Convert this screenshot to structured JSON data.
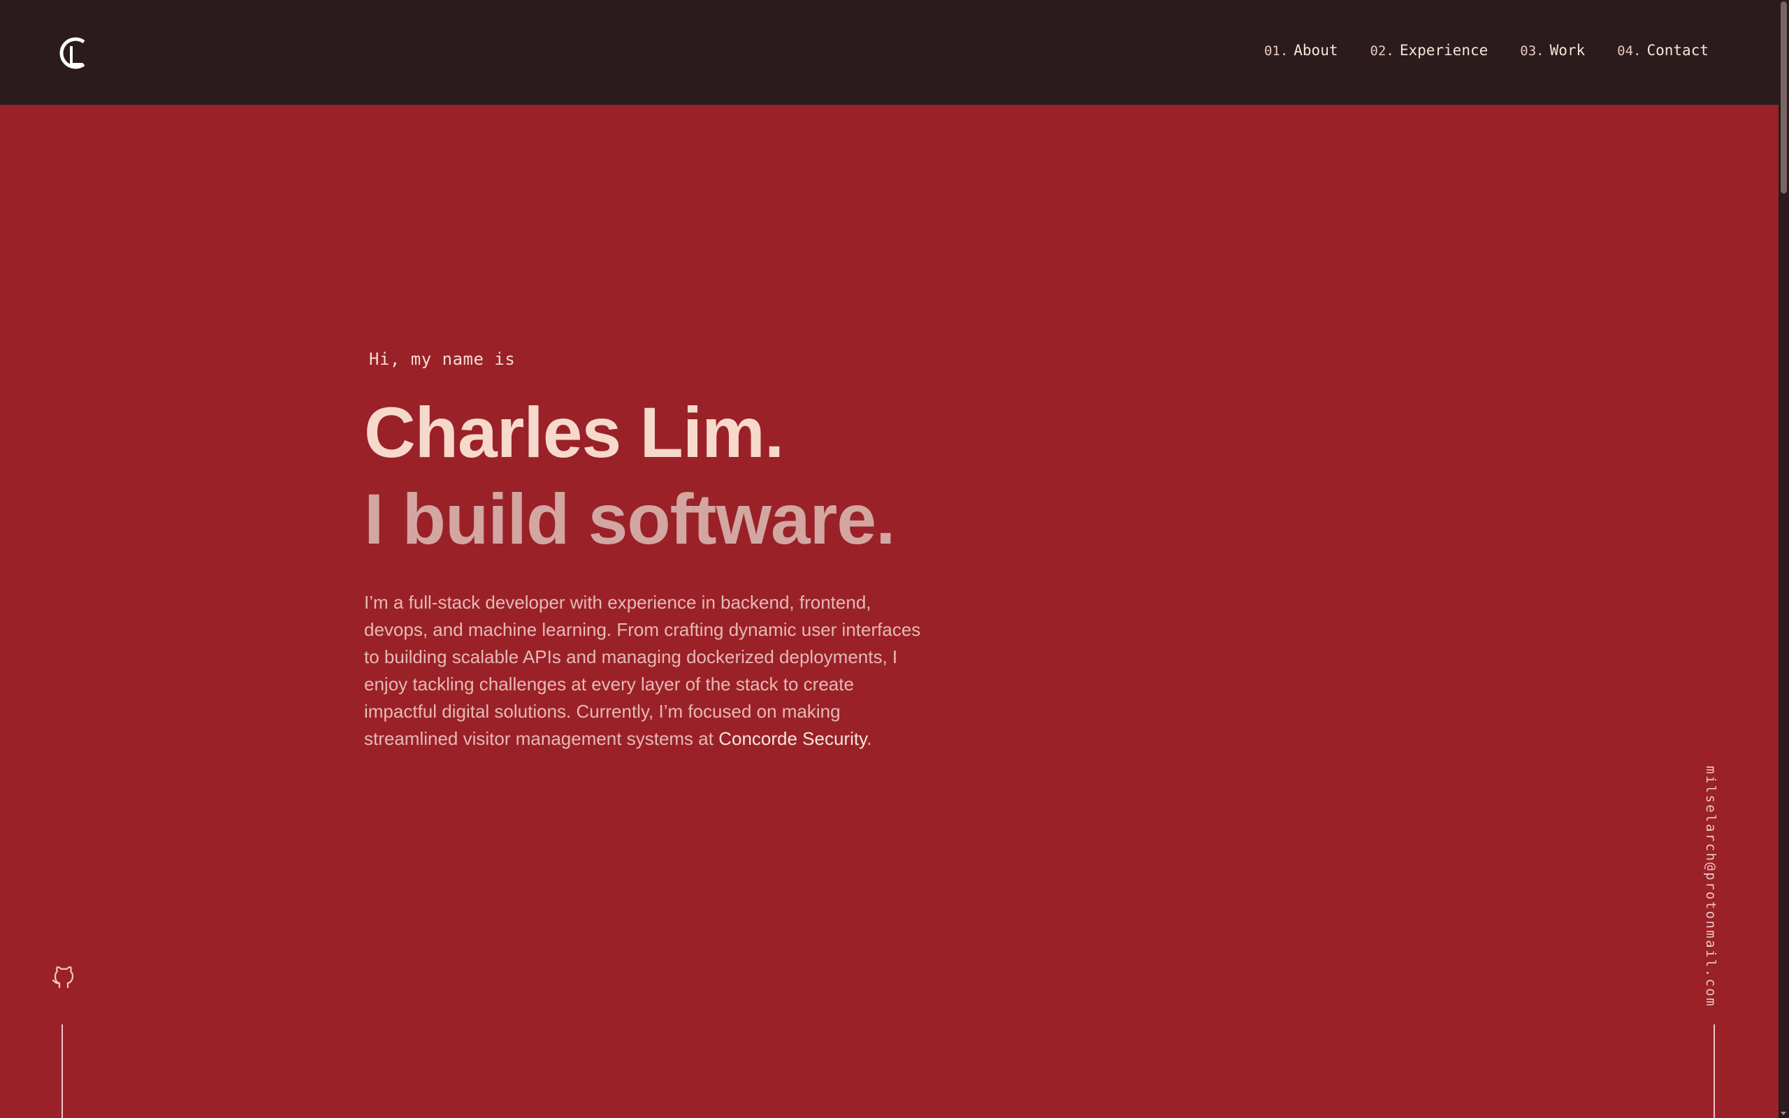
{
  "header": {
    "logo_icon": "c-monogram-icon",
    "nav": [
      {
        "num": "01.",
        "label": "About"
      },
      {
        "num": "02.",
        "label": "Experience"
      },
      {
        "num": "03.",
        "label": "Work"
      },
      {
        "num": "04.",
        "label": "Contact"
      }
    ]
  },
  "hero": {
    "greeting": "Hi, my name is",
    "name": "Charles Lim.",
    "tagline": "I build software.",
    "bio_text": "I’m a full-stack developer with experience in backend, frontend, devops, and machine learning. From crafting dynamic user interfaces to building scalable APIs and managing dockerized deployments, I enjoy tackling challenges at every layer of the stack to create impactful digital solutions. Currently, I’m focused on making streamlined visitor management systems at ",
    "bio_link": "Concorde Security",
    "bio_end": "."
  },
  "social": {
    "github_icon": "github-icon"
  },
  "email": "milselarch@protonmail.com",
  "colors": {
    "background": "#9a2128",
    "header": "#2b1b1c",
    "name": "#f7d9cc",
    "tagline": "#d3a6a2",
    "body": "#e6b9b5"
  }
}
